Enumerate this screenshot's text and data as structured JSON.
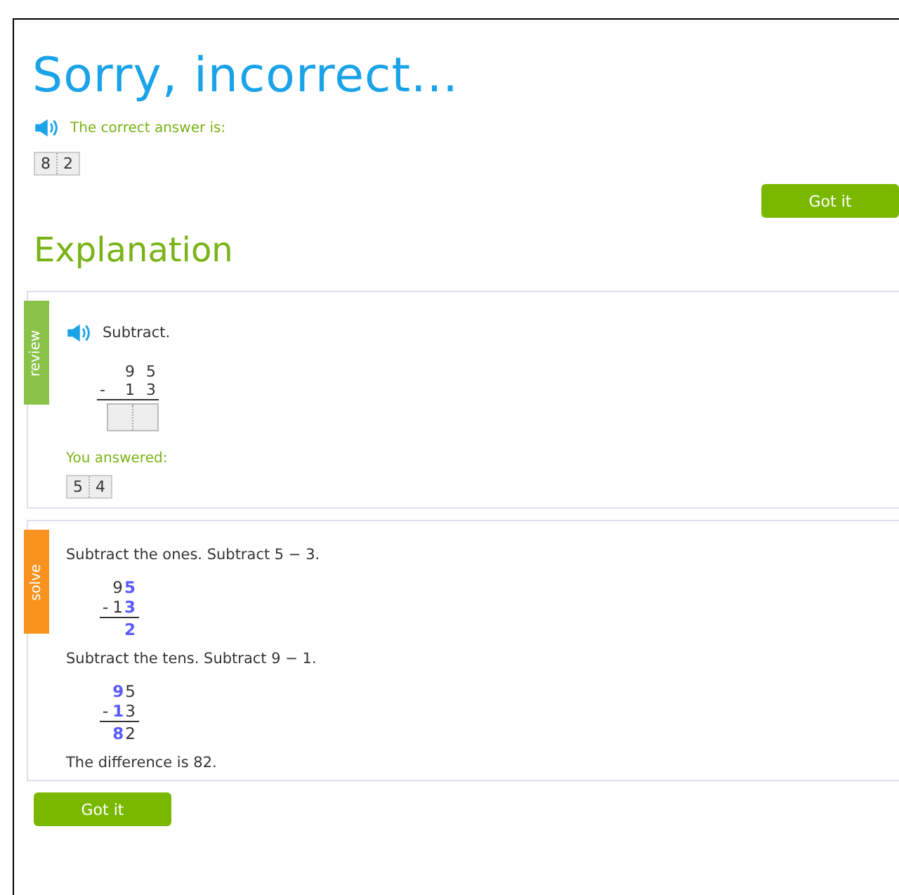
{
  "title": "Sorry, incorrect...",
  "correct_answer": {
    "label": "The correct answer is:",
    "digits": [
      "8",
      "2"
    ]
  },
  "got_it_top": "Got it",
  "explanation_heading": "Explanation",
  "sections": [
    {
      "kind": "review",
      "tab": "review",
      "prompt": "Subtract.",
      "top": [
        {
          "d": "9",
          "highlight": false
        },
        {
          "d": "5",
          "highlight": false
        }
      ],
      "operator": "-",
      "bottom": [
        {
          "d": "1",
          "highlight": false
        },
        {
          "d": "3",
          "highlight": false
        }
      ],
      "blanks": [
        {
          "kind": "empty"
        },
        {
          "kind": "empty"
        }
      ],
      "answered_label": "You answered:",
      "answered": [
        "5",
        "4"
      ]
    },
    {
      "kind": "solve",
      "tab": "solve",
      "steps": [
        {
          "text": "Subtract the ones. Subtract 5 − 3.",
          "top": [
            {
              "d": "9",
              "highlight": false
            },
            {
              "d": "5",
              "highlight": true
            }
          ],
          "operator": "-",
          "bottom": [
            {
              "d": "1",
              "highlight": false
            },
            {
              "d": "3",
              "highlight": true
            }
          ],
          "result": [
            {
              "d": "2",
              "highlight": true
            }
          ]
        },
        {
          "text": "Subtract the tens. Subtract 9 − 1.",
          "top": [
            {
              "d": "9",
              "highlight": true
            },
            {
              "d": "5",
              "highlight": false
            }
          ],
          "operator": "-",
          "bottom": [
            {
              "d": "1",
              "highlight": true
            },
            {
              "d": "3",
              "highlight": false
            }
          ],
          "result": [
            {
              "d": "8",
              "highlight": true
            },
            {
              "d": "2",
              "highlight": false
            }
          ]
        }
      ],
      "conclusion": "The difference is 82."
    }
  ],
  "got_it_bottom": "Got it"
}
